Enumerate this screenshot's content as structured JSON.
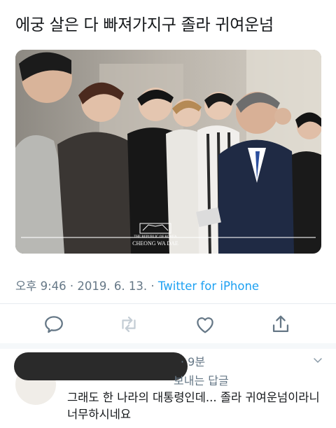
{
  "tweet": {
    "text": "에궁 살은 다 빠져가지구 졸라 귀여운넘",
    "time": "오후 9:46",
    "date": "2019. 6. 13.",
    "sep": " · ",
    "via": "Twitter for iPhone"
  },
  "media": {
    "watermark_line1": "THE REPUBLIC OF KOREA",
    "watermark_line2": "CHEONG WA DAE"
  },
  "actions": {
    "reply_icon": "reply-icon",
    "retweet_icon": "retweet-icon",
    "like_icon": "heart-icon",
    "share_icon": "share-icon"
  },
  "reply": {
    "time_tail": "· 9분",
    "reply_to": "보내는 답글",
    "text": "그래도 한 나라의 대통령인데... 졸라 귀여운넘이라니 너무하시네요"
  },
  "colors": {
    "accent": "#1da1f2",
    "muted": "#657786"
  }
}
